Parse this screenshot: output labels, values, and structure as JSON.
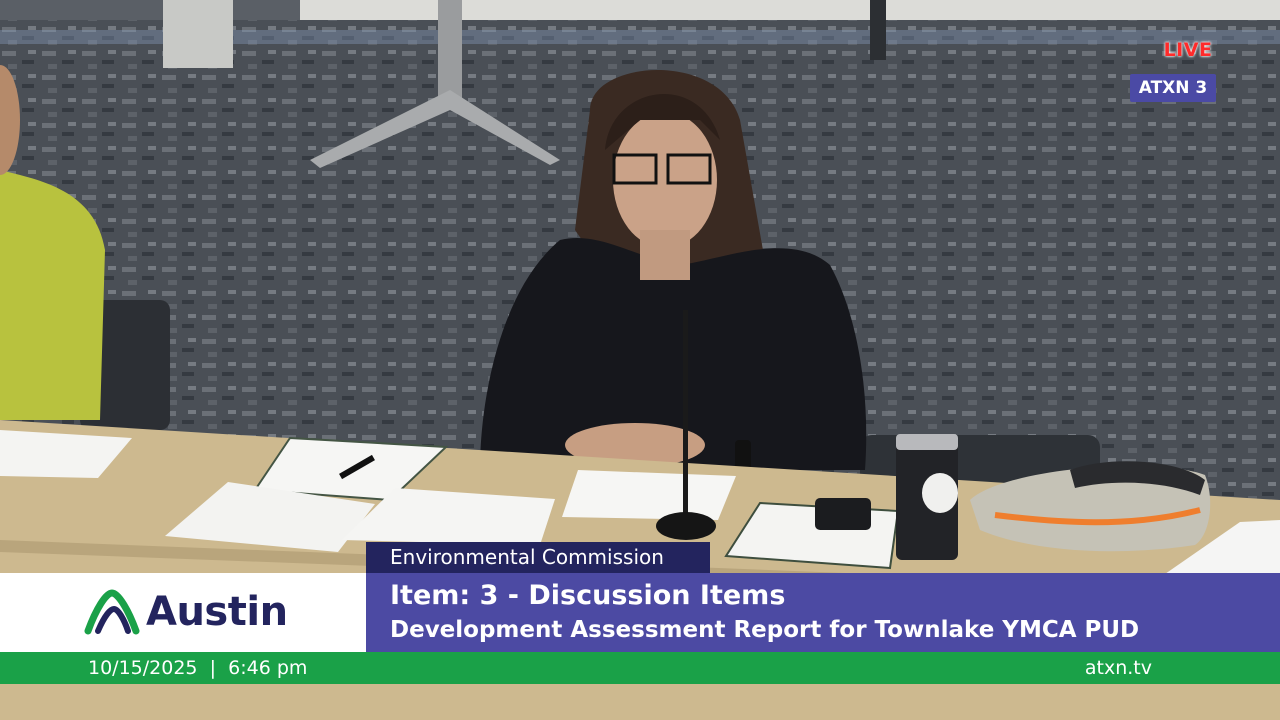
{
  "broadcast": {
    "live_label": "LIVE",
    "channel_label": "ATXN 3"
  },
  "lower_third": {
    "commission": "Environmental Commission",
    "logo_text": "Austin",
    "item_title": "Item: 3 - Discussion Items",
    "item_subtitle": "Development Assessment Report for Townlake YMCA PUD",
    "date": "10/15/2025",
    "separator": "|",
    "time": "6:46 pm",
    "website": "atxn.tv"
  },
  "colors": {
    "live_red": "#ff2a2a",
    "channel_purple": "#4b4aa5",
    "navy": "#23245e",
    "title_purple": "#4c4aa3",
    "green": "#1aa148"
  }
}
